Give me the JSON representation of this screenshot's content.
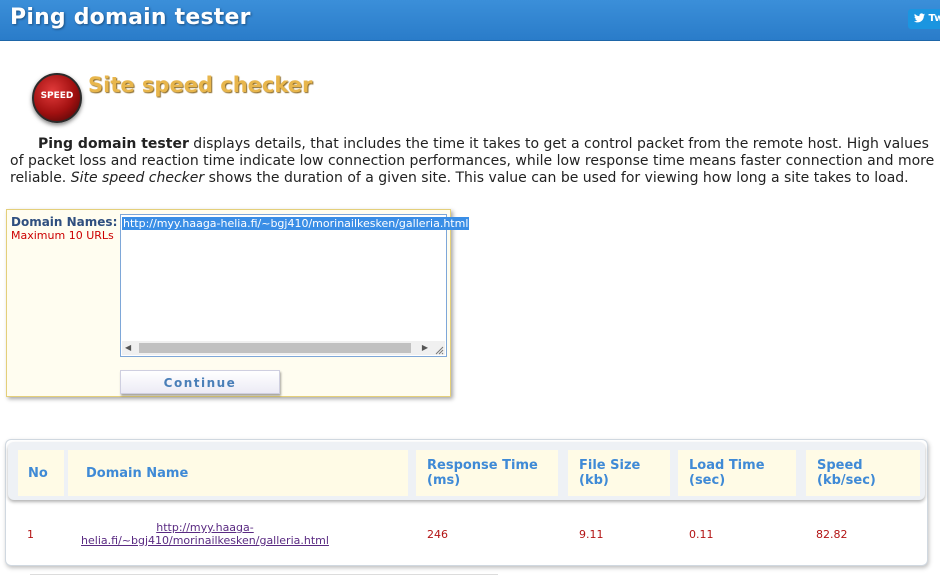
{
  "header": {
    "title": "Ping domain tester",
    "twitter_label": "Tw"
  },
  "logo": {
    "text": "SPEED"
  },
  "subtitle": "Site speed checker",
  "description": {
    "bold_lead": "Ping domain tester",
    "text1": " displays details, that includes the time it takes to get a control packet from the remote host. High values of packet loss and reaction time indicate low connection performances, while low response time means faster connection and more reliable. ",
    "italic": "Site speed checker",
    "text2": " shows the duration of a given site. This value can be used for viewing how long a site takes to load."
  },
  "form": {
    "domain_label": "Domain Names:",
    "max_label": "Maximum 10 URLs",
    "textarea_value": "http://myy.haaga-helia.fi/~bgj410/morinailkesken/galleria.html",
    "continue_label": "Continue"
  },
  "table": {
    "headers": {
      "no": "No",
      "domain": "Domain Name",
      "response_1": "Response Time",
      "response_2": "(ms)",
      "filesize_1": "File Size",
      "filesize_2": "(kb)",
      "loadtime_1": "Load Time",
      "loadtime_2": "(sec)",
      "speed_1": "Speed",
      "speed_2": "(kb/sec)"
    },
    "row": {
      "no": "1",
      "domain_line1": "http://myy.haaga-",
      "domain_line2": "helia.fi/~bgj410/morinailkesken/galleria.html",
      "response": "246",
      "filesize": "9.11",
      "loadtime": "0.11",
      "speed": "82.82"
    }
  },
  "colors": {
    "header_bg": "#2a7cc9",
    "accent_gold": "#e8b64c",
    "table_header_text": "#3f8ad6",
    "value_red": "#b31414"
  }
}
